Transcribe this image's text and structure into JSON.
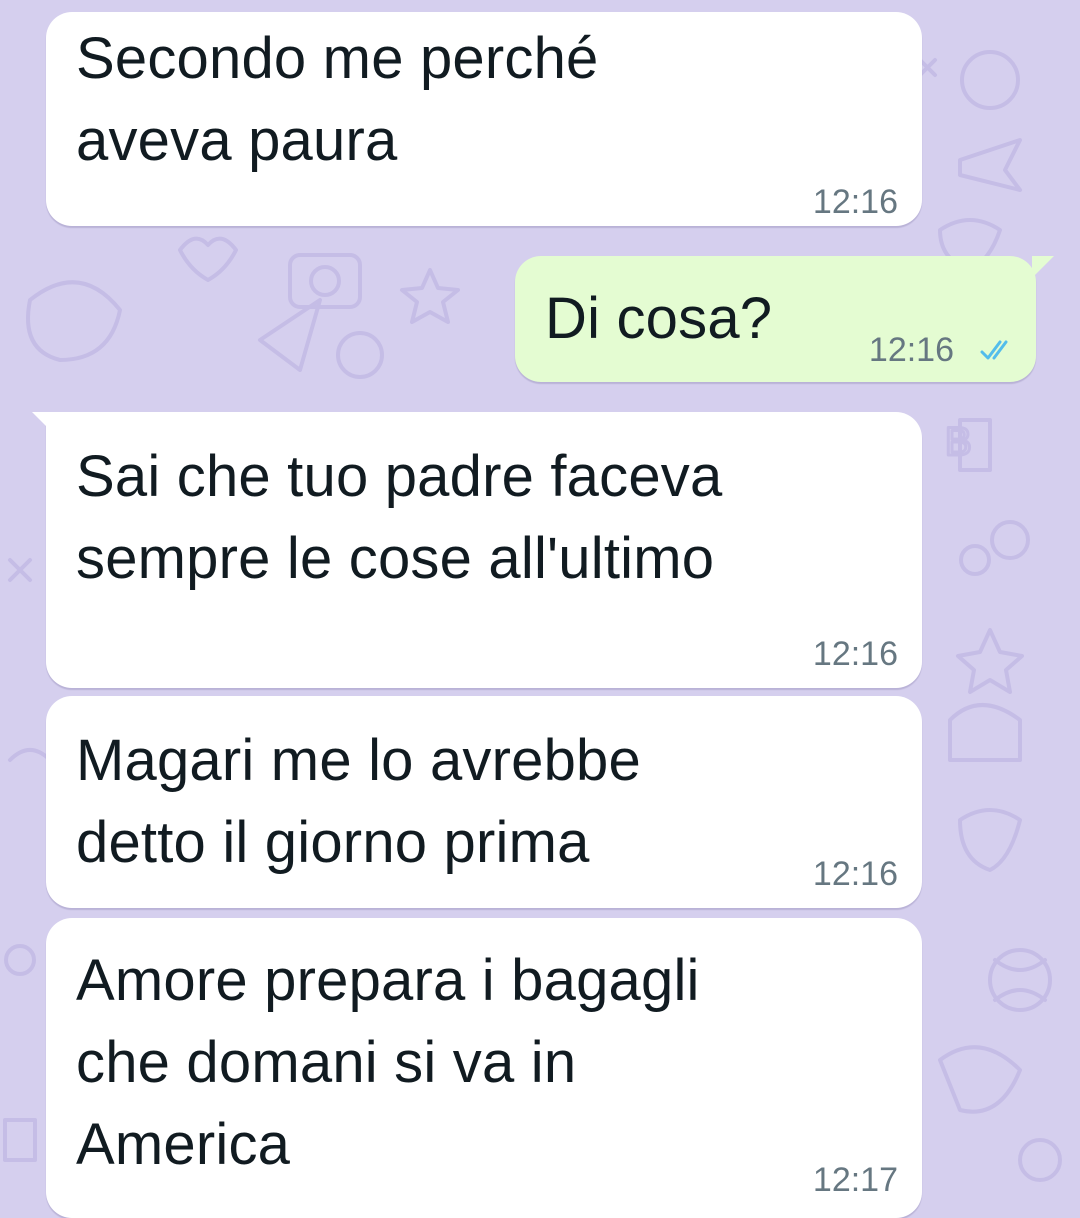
{
  "theme": {
    "wallpaper": "#d5cfee",
    "incoming_bubble": "#ffffff",
    "outgoing_bubble": "#e4fcd2",
    "text": "#111b21",
    "timestamp": "#667781",
    "read_ticks": "#53bdeb"
  },
  "messages": [
    {
      "direction": "incoming",
      "text": "Secondo me perché\naveva paura",
      "time": "12:16"
    },
    {
      "direction": "outgoing",
      "text": "Di cosa?",
      "time": "12:16",
      "status": "read",
      "status_icon": "double-check-icon"
    },
    {
      "direction": "incoming",
      "text": "Sai che tuo padre faceva\nsempre le cose all'ultimo",
      "time": "12:16"
    },
    {
      "direction": "incoming",
      "text": "Magari me lo avrebbe\ndetto il giorno prima",
      "time": "12:16"
    },
    {
      "direction": "incoming",
      "text": "Amore prepara i bagagli\nche domani si va in\nAmerica",
      "time": "12:17"
    }
  ]
}
